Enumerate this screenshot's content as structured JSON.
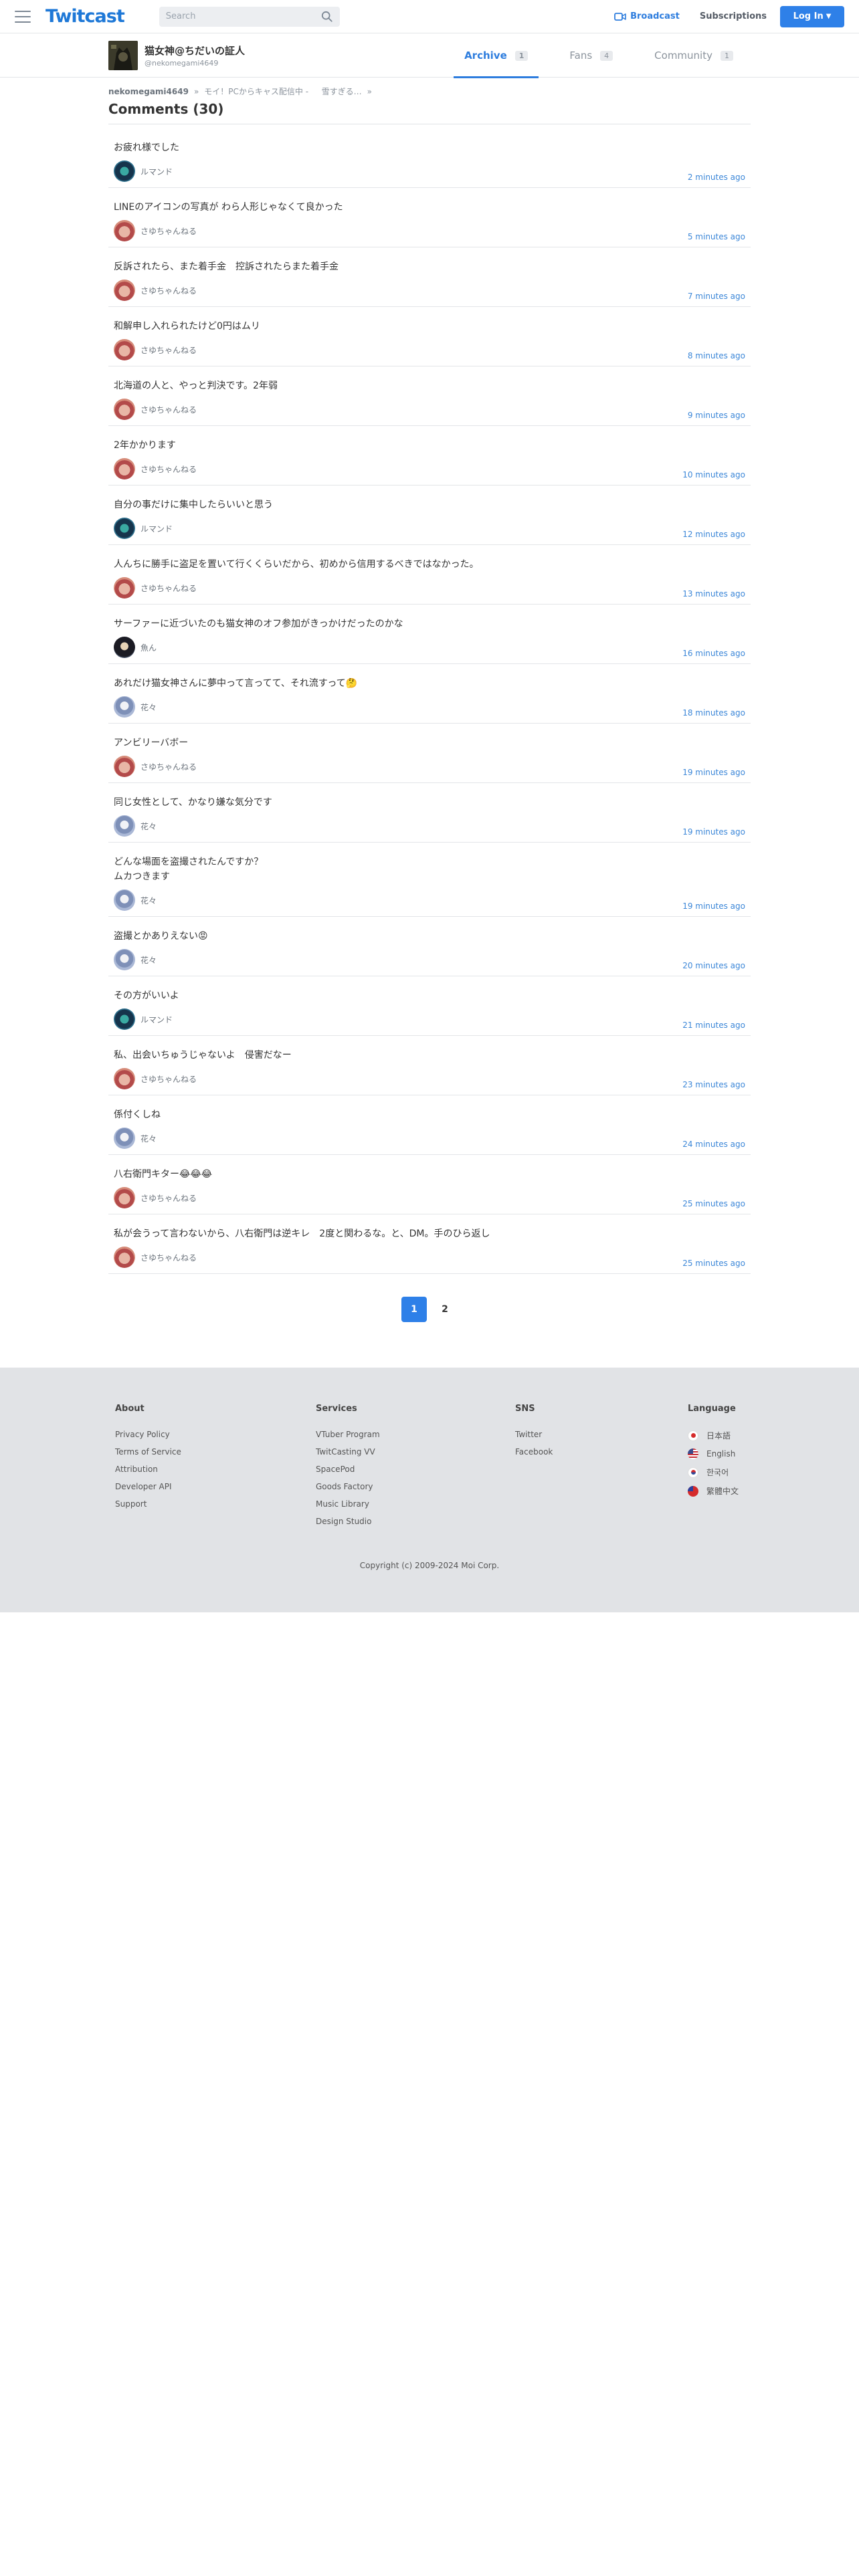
{
  "header": {
    "logo": "Twitcast",
    "search_placeholder": "Search",
    "broadcast": "Broadcast",
    "subscriptions": "Subscriptions",
    "login": "Log In"
  },
  "profile": {
    "name": "猫女神@ちだいの証人",
    "id": "@nekomegami4649",
    "tabs": [
      {
        "label": "Archive",
        "count": "1"
      },
      {
        "label": "Fans",
        "count": "4"
      },
      {
        "label": "Community",
        "count": "1"
      }
    ]
  },
  "breadcrumb": {
    "user": "nekomegami4649",
    "movie": "モイ！PCからキャス配信中 - 　 雪すぎる…",
    "sep": "»"
  },
  "page_title": "Comments (30)",
  "comments": [
    {
      "text": "お疲れ様でした",
      "user": "ルマンド",
      "time": "2 minutes ago",
      "avatar": "teal"
    },
    {
      "text": "LINEのアイコンの写真が わら人形じゃなくて良かった",
      "user": "さゆちゃんねる",
      "time": "5 minutes ago",
      "avatar": "red"
    },
    {
      "text": "反訴されたら、また着手金　控訴されたらまた着手金",
      "user": "さゆちゃんねる",
      "time": "7 minutes ago",
      "avatar": "red"
    },
    {
      "text": "和解申し入れられたけど0円はムリ",
      "user": "さゆちゃんねる",
      "time": "8 minutes ago",
      "avatar": "red"
    },
    {
      "text": "北海道の人と、やっと判決です。2年弱",
      "user": "さゆちゃんねる",
      "time": "9 minutes ago",
      "avatar": "red"
    },
    {
      "text": "2年かかります",
      "user": "さゆちゃんねる",
      "time": "10 minutes ago",
      "avatar": "red"
    },
    {
      "text": "自分の事だけに集中したらいいと思う",
      "user": "ルマンド",
      "time": "12 minutes ago",
      "avatar": "teal"
    },
    {
      "text": "人んちに勝手に盗足を置いて行くくらいだから、初めから信用するべきではなかった。",
      "user": "さゆちゃんねる",
      "time": "13 minutes ago",
      "avatar": "red"
    },
    {
      "text": "サーファーに近づいたのも猫女神のオフ参加がきっかけだったのかな",
      "user": "魚ん",
      "time": "16 minutes ago",
      "avatar": "dark"
    },
    {
      "text": "あれだけ猫女神さんに夢中って言ってて、それ流すって🤔",
      "user": "花々",
      "time": "18 minutes ago",
      "avatar": "blue"
    },
    {
      "text": "アンビリーバボー",
      "user": "さゆちゃんねる",
      "time": "19 minutes ago",
      "avatar": "red"
    },
    {
      "text": "同じ女性として、かなり嫌な気分です",
      "user": "花々",
      "time": "19 minutes ago",
      "avatar": "blue"
    },
    {
      "text": "どんな場面を盗撮されたんですか？\nムカつきます",
      "user": "花々",
      "time": "19 minutes ago",
      "avatar": "blue"
    },
    {
      "text": "盗撮とかありえない😡",
      "user": "花々",
      "time": "20 minutes ago",
      "avatar": "blue"
    },
    {
      "text": "その方がいいよ",
      "user": "ルマンド",
      "time": "21 minutes ago",
      "avatar": "teal"
    },
    {
      "text": "私、出会いちゅうじゃないよ　侵害だなー",
      "user": "さゆちゃんねる",
      "time": "23 minutes ago",
      "avatar": "red"
    },
    {
      "text": "係付くしね",
      "user": "花々",
      "time": "24 minutes ago",
      "avatar": "blue"
    },
    {
      "text": "八右衛門キター😂😂😂",
      "user": "さゆちゃんねる",
      "time": "25 minutes ago",
      "avatar": "red"
    },
    {
      "text": "私が会うって言わないから、八右衛門は逆キレ　2度と関わるな。と、DM。手のひら返し",
      "user": "さゆちゃんねる",
      "time": "25 minutes ago",
      "avatar": "red"
    }
  ],
  "pagination": [
    "1",
    "2"
  ],
  "footer": {
    "about": {
      "title": "About",
      "links": [
        "Privacy Policy",
        "Terms of Service",
        "Attribution",
        "Developer API",
        "Support"
      ]
    },
    "services": {
      "title": "Services",
      "links": [
        "VTuber Program",
        "TwitCasting VV",
        "SpacePod",
        "Goods Factory",
        "Music Library",
        "Design Studio"
      ]
    },
    "sns": {
      "title": "SNS",
      "links": [
        "Twitter",
        "Facebook"
      ]
    },
    "language": {
      "title": "Language",
      "items": [
        {
          "label": "日本語",
          "flag": "jp"
        },
        {
          "label": "English",
          "flag": "us"
        },
        {
          "label": "한국어",
          "flag": "kr"
        },
        {
          "label": "繁體中文",
          "flag": "tw"
        }
      ]
    },
    "copyright": "Copyright (c) 2009-2024 Moi Corp."
  }
}
